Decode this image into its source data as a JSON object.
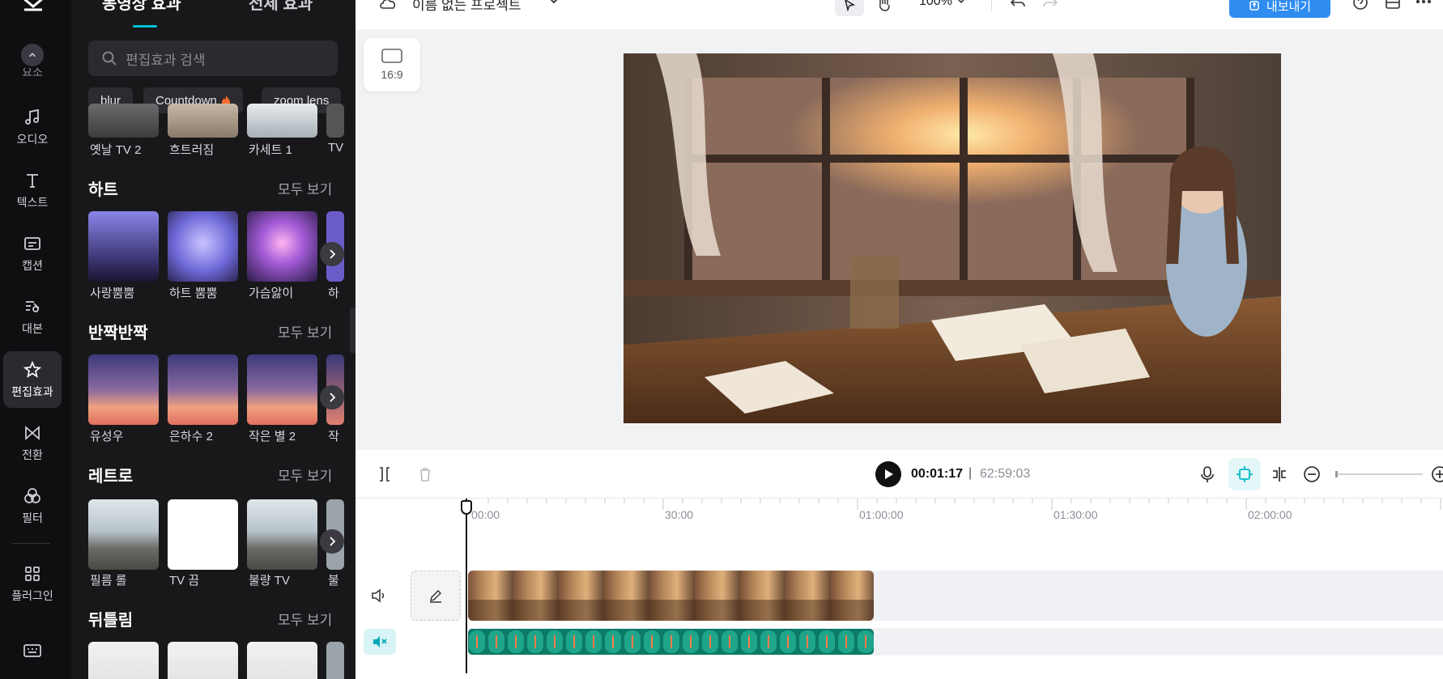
{
  "nav": {
    "items": [
      {
        "label": "요소",
        "icon": "elements-icon"
      },
      {
        "label": "오디오",
        "icon": "music-note-icon"
      },
      {
        "label": "텍스트",
        "icon": "text-icon"
      },
      {
        "label": "캡션",
        "icon": "captions-icon"
      },
      {
        "label": "대본",
        "icon": "script-icon"
      },
      {
        "label": "편집효과",
        "icon": "magic-star-icon"
      },
      {
        "label": "전환",
        "icon": "transition-icon"
      },
      {
        "label": "필터",
        "icon": "filter-icon"
      },
      {
        "label": "플러그인",
        "icon": "plugins-icon"
      }
    ]
  },
  "panel": {
    "tabs": [
      "동영상 효과",
      "전체 효과"
    ],
    "search_placeholder": "편집효과 검색",
    "chips": [
      "blur",
      "Countdown",
      "zoom lens"
    ],
    "top_row_labels": [
      "옛날 TV 2",
      "흐트러짐",
      "카세트 1",
      "TV"
    ],
    "see_all": "모두 보기",
    "sections": [
      {
        "title": "하트",
        "items": [
          "사랑뿜뿜",
          "하트 뿜뿜",
          "가슴앓이",
          "하"
        ]
      },
      {
        "title": "반짝반짝",
        "items": [
          "유성우",
          "은하수 2",
          "작은 별 2",
          "작"
        ]
      },
      {
        "title": "레트로",
        "items": [
          "필름 롤",
          "TV 끔",
          "불량 TV",
          "불"
        ]
      },
      {
        "title": "뒤틀림",
        "items": []
      }
    ]
  },
  "topbar": {
    "project_name": "이름 없는 프로젝트",
    "zoom": "100%",
    "export_label": "내보내기"
  },
  "canvas": {
    "aspect_ratio": "16:9"
  },
  "playback": {
    "current_time": "00:01:17",
    "separator": "|",
    "total_time": "62:59:03"
  },
  "timeline": {
    "ticks": [
      "00:00",
      "30:00",
      "01:00:00",
      "01:30:00",
      "02:00:00"
    ]
  },
  "colors": {
    "accent": "#00c2d1",
    "export_blue": "#2f8cf0",
    "audio_clip": "#1fa58a"
  }
}
